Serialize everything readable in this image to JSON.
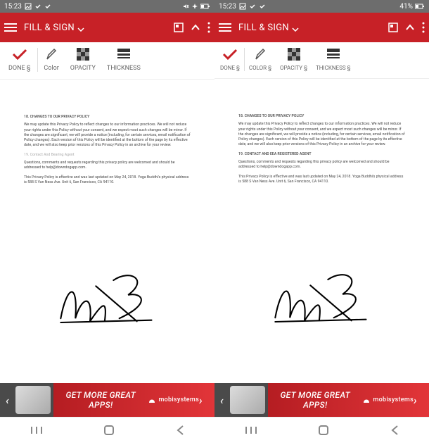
{
  "left": {
    "status": {
      "time": "15:23",
      "battery": ""
    },
    "header": {
      "title": "FILL & SIGN"
    },
    "tools": {
      "done": "DONE §",
      "color": "Color",
      "opacity": "OPACITY",
      "thickness": "THICKNESS"
    },
    "doc": {
      "sec18_title": "18. CHANGES TO OUR PRIVACY POLICY",
      "sec18_body": "We may update this Privacy Policy to reflect changes to our information practices. We will not reduce your rights under this Policy without your consent, and we expect most such changes will be minor. If the changes are significant, we will provide a notice (including, for certain services, email notification of Policy changes). Each version of this Policy will be identified at the bottom of the page by its effective date, and we will also keep prior versions of this Privacy Policy in an archive for your review.",
      "sec19_title": "19. Contact And Bearing Agent",
      "sec19_body": "Questions, comments and requests regarding this privacy policy are welcomed and should be addressed to help@downdogapp.com.",
      "footer": "This Privacy Policy is effective and was last updated on May 24, 2018. Yoga Buddhi's physical address is 588 S Van Ness Ave. Unit 6, San Francisco, CA 94110."
    },
    "ad": {
      "text": "GET MORE GREAT APPS!",
      "brand": "mobisystems"
    }
  },
  "right": {
    "status": {
      "time": "15:23",
      "battery": "41%"
    },
    "header": {
      "title": "FILL & SIGN"
    },
    "tools": {
      "done": "DONE §",
      "color": "COLOR §",
      "opacity": "OPACITY §",
      "thickness": "THICKNESS §"
    },
    "doc": {
      "sec18_title": "18. CHANGES TO OUR PRIVACY POLICY",
      "sec18_body": "We may update this Privacy Policy to reflect changes to our information practices. We will not reduce your rights under this Policy without your consent, and we expect most such changes will be minor. If the changes are significant, we will provide a notice (including, for certain services, email notification of Policy changes). Each version of this Policy will be identified at the bottom of the page by its effective date, and we will also keep prior versions of this Privacy Policy in an archive for your review.",
      "sec19_title": "19. CONTACT AND EEA REGISTERED AGENT",
      "sec19_body": "Questions, comments and requests regarding this privacy policy are welcomed and should be addressed to help@downdogapp.com.",
      "footer": "This Privacy Policy is effective and was last updated on May 24, 2018. Yoga Buddhi's physical address is 588 S Van Ness Ave. Unit 6, San Francisco, CA 94110."
    },
    "ad": {
      "text": "GET MORE GREAT APPS!",
      "brand": "mobisystems"
    }
  }
}
